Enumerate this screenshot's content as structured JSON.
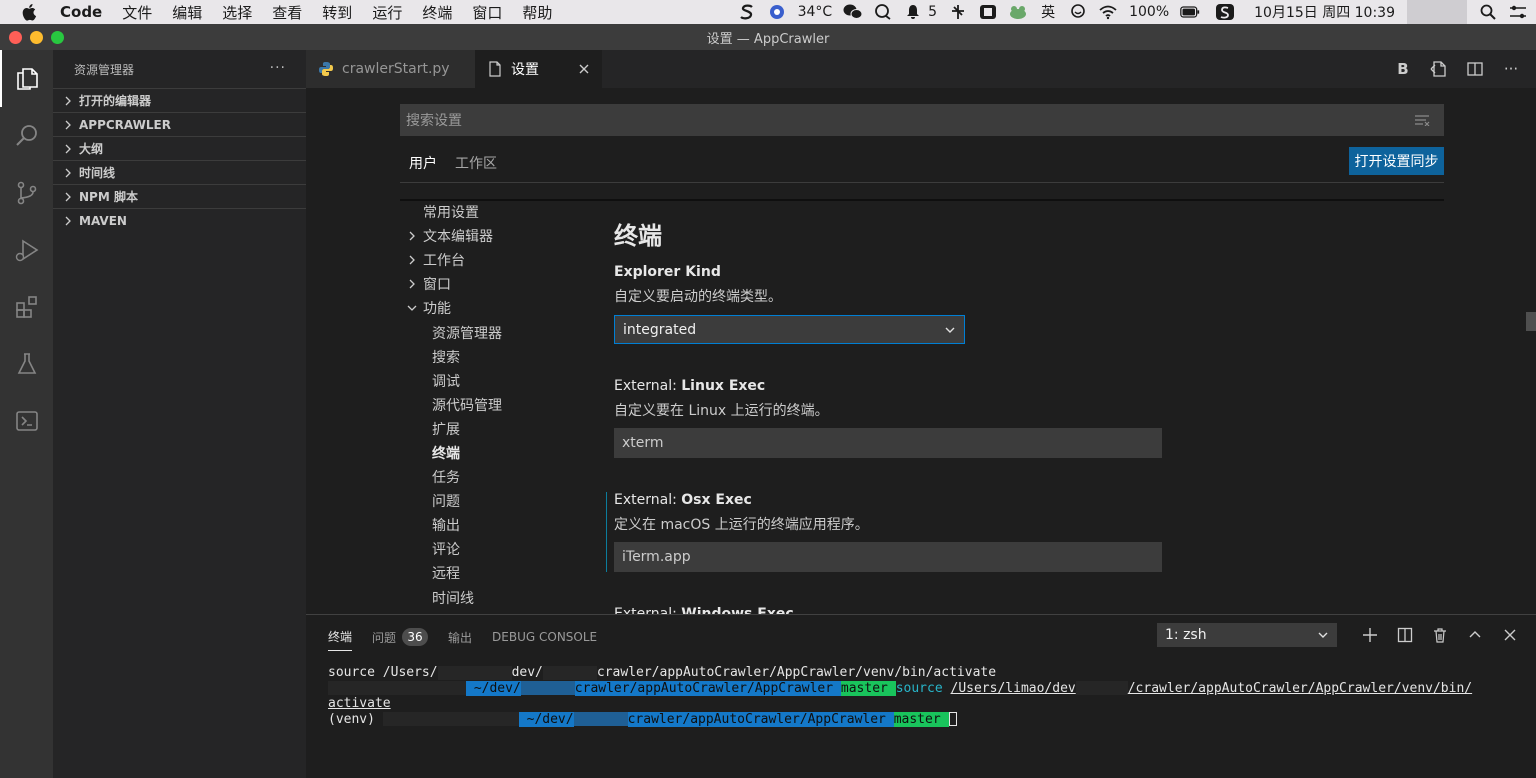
{
  "menubar": {
    "app": "Code",
    "items": [
      "文件",
      "编辑",
      "选择",
      "查看",
      "转到",
      "运行",
      "终端",
      "窗口",
      "帮助"
    ],
    "weather": "34°C",
    "notification_count": "5",
    "ime": "英",
    "battery": "100%",
    "datetime": "10月15日 周四 10:39"
  },
  "window": {
    "title": "设置 — AppCrawler"
  },
  "sidebar": {
    "title": "资源管理器",
    "more": "···",
    "sections": [
      "打开的编辑器",
      "APPCRAWLER",
      "大纲",
      "时间线",
      "NPM 脚本",
      "MAVEN"
    ]
  },
  "tabs": [
    {
      "label": "crawlerStart.py"
    },
    {
      "label": "设置"
    }
  ],
  "editor_actions": {
    "bold": "B",
    "more": "···"
  },
  "settings": {
    "search_placeholder": "搜索设置",
    "scope_tabs": [
      "用户",
      "工作区"
    ],
    "sync_button": "打开设置同步",
    "toc": {
      "common": "常用设置",
      "text_editor": "文本编辑器",
      "workbench": "工作台",
      "window": "窗口",
      "features": "功能",
      "feature_items": [
        "资源管理器",
        "搜索",
        "调试",
        "源代码管理",
        "扩展",
        "终端",
        "任务",
        "问题",
        "输出",
        "评论",
        "远程",
        "时间线"
      ]
    },
    "group_title": "终端",
    "explorer_kind": {
      "title": "Explorer Kind",
      "desc": "自定义要启动的终端类型。",
      "value": "integrated"
    },
    "linux_exec": {
      "prefix": "External: ",
      "title": "Linux Exec",
      "desc": "自定义要在 Linux 上运行的终端。",
      "value": "xterm"
    },
    "osx_exec": {
      "prefix": "External: ",
      "title": "Osx Exec",
      "desc": "定义在 macOS 上运行的终端应用程序。",
      "value": "iTerm.app"
    },
    "windows_exec": {
      "prefix": "External: ",
      "title": "Windows Exec"
    }
  },
  "panel": {
    "tabs": [
      "终端",
      "问题",
      "输出",
      "DEBUG CONSOLE"
    ],
    "problems_count": "36",
    "terminal_select": "1: zsh",
    "lines": {
      "l1a": "source /Users/",
      "l1b": "dev/",
      "l1c": "crawler/appAutoCrawler/AppCrawler/venv/bin/activate",
      "l2_path_a": " ~/dev/",
      "l2_path_b": "crawler/appAutoCrawler/AppCrawler ",
      "l2_branch": "  master ",
      "l2_source": " source ",
      "l2_cmd_a": "/Users/limao/dev",
      "l2_cmd_b": "/crawler/appAutoCrawler/AppCrawler/venv/bin/",
      "l3": "activate",
      "l4_venv": "(venv) ",
      "l4_path_a": " ~/dev/",
      "l4_path_b": "crawler/appAutoCrawler/AppCrawler ",
      "l4_branch": "  master "
    }
  }
}
